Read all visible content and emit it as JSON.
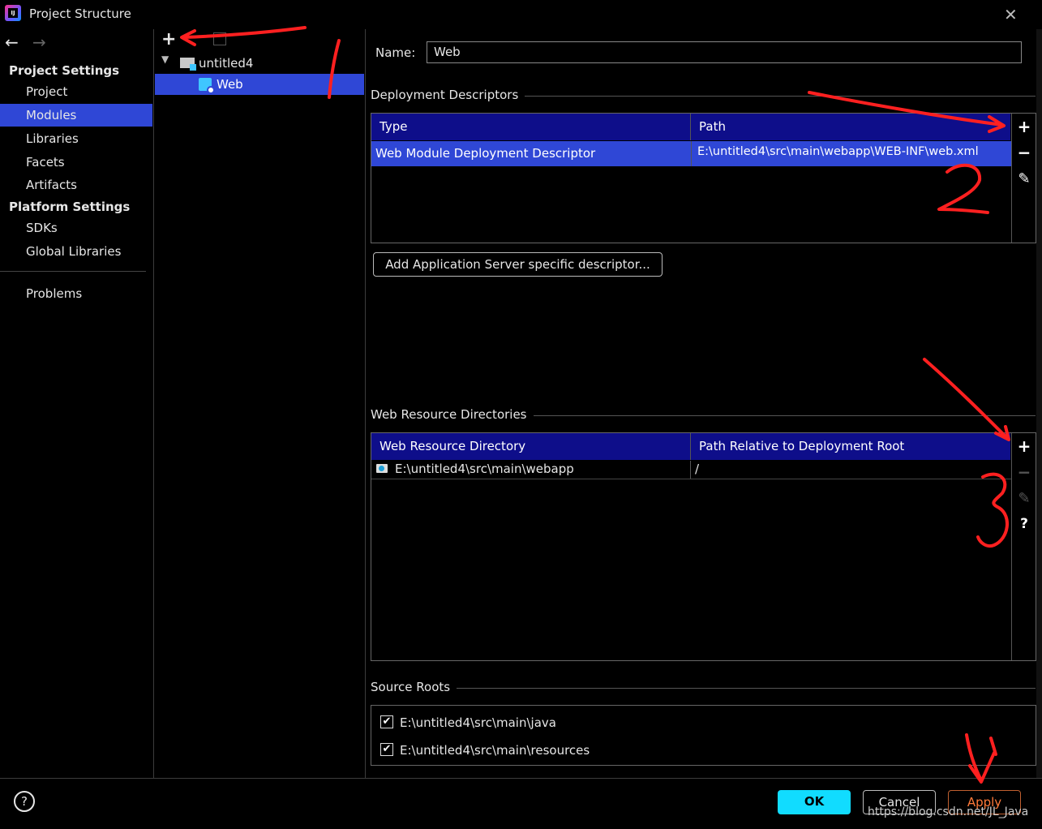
{
  "window": {
    "title": "Project Structure",
    "close_icon": "✕"
  },
  "nav": {
    "back_icon": "←",
    "forward_icon": "→",
    "project_settings_header": "Project Settings",
    "platform_settings_header": "Platform Settings",
    "items_project": [
      "Project",
      "Modules",
      "Libraries",
      "Facets",
      "Artifacts"
    ],
    "items_platform": [
      "SDKs",
      "Global Libraries"
    ],
    "problems": "Problems",
    "selected": "Modules"
  },
  "tree": {
    "add_icon": "+",
    "root": "untitled4",
    "child": "Web"
  },
  "facet": {
    "name_label": "Name:",
    "name_value": "Web",
    "deployment": {
      "title": "Deployment Descriptors",
      "columns": [
        "Type",
        "Path"
      ],
      "rows": [
        {
          "type": "Web Module Deployment Descriptor",
          "path": "E:\\untitled4\\src\\main\\webapp\\WEB-INF\\web.xml"
        }
      ]
    },
    "add_server_descriptor": "Add Application Server specific descriptor...",
    "web_resources": {
      "title": "Web Resource Directories",
      "columns": [
        "Web Resource Directory",
        "Path Relative to Deployment Root"
      ],
      "rows": [
        {
          "dir": "E:\\untitled4\\src\\main\\webapp",
          "relative": "/"
        }
      ]
    },
    "source_roots": {
      "title": "Source Roots",
      "items": [
        "E:\\untitled4\\src\\main\\java",
        "E:\\untitled4\\src\\main\\resources"
      ]
    }
  },
  "footer": {
    "help": "?",
    "ok": "OK",
    "cancel": "Cancel",
    "apply": "Apply",
    "watermark": "https://blog.csdn.net/JL_Java"
  },
  "annotations": {
    "one": "1",
    "two": "2",
    "three": "3"
  },
  "colors": {
    "selection": "#2f47d6",
    "table_header": "#0e0e8a",
    "ok": "#11dcff",
    "annotation": "#ff2020"
  }
}
